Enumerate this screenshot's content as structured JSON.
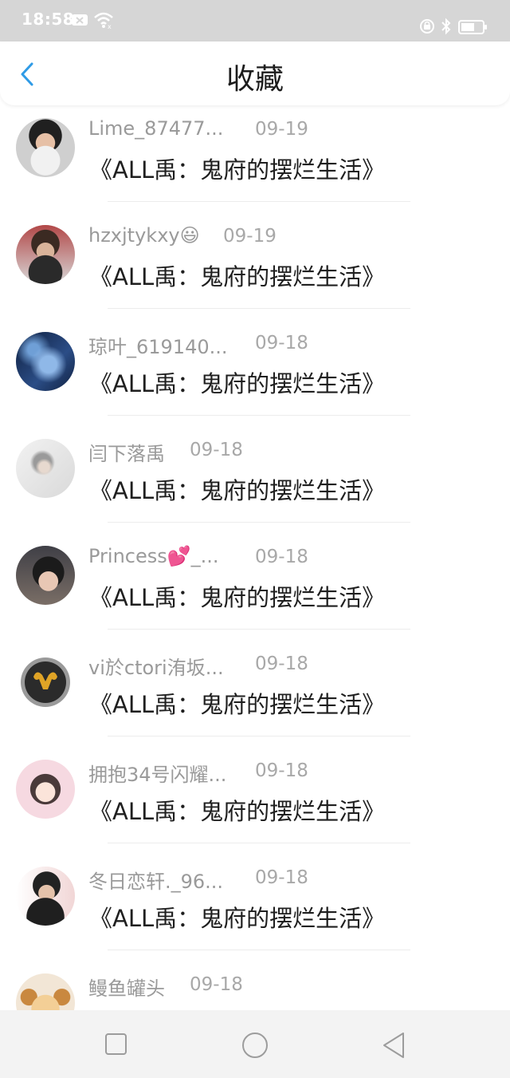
{
  "status_bar": {
    "time": "18:58",
    "icons": [
      "sim-off-icon",
      "wifi-icon",
      "alarm-icon",
      "bluetooth-icon",
      "battery-icon"
    ]
  },
  "header": {
    "title": "收藏",
    "back_icon": "chevron-left-icon",
    "accent_color": "#2f9be6"
  },
  "items": [
    {
      "username": "Lime_87477...",
      "date": "09-19",
      "title": "《ALL禹：鬼府的摆烂生活》"
    },
    {
      "username": "hzxjtykxy😃",
      "date": "09-19",
      "title": "《ALL禹：鬼府的摆烂生活》"
    },
    {
      "username": "琼叶_619140...",
      "date": "09-18",
      "title": "《ALL禹：鬼府的摆烂生活》"
    },
    {
      "username": "闫下落禹",
      "date": "09-18",
      "title": "《ALL禹：鬼府的摆烂生活》"
    },
    {
      "username": "Princess💕_...",
      "date": "09-18",
      "title": "《ALL禹：鬼府的摆烂生活》"
    },
    {
      "username": "vi於ctori洧坂...",
      "date": "09-18",
      "title": "《ALL禹：鬼府的摆烂生活》"
    },
    {
      "username": "拥抱34号闪耀...",
      "date": "09-18",
      "title": "《ALL禹：鬼府的摆烂生活》"
    },
    {
      "username": "冬日恋轩._96...",
      "date": "09-18",
      "title": "《ALL禹：鬼府的摆烂生活》"
    },
    {
      "username": "鳗鱼罐头",
      "date": "09-18",
      "title": ""
    }
  ],
  "nav_bar": {
    "buttons": [
      "recent-apps-icon",
      "home-icon",
      "back-triangle-icon"
    ]
  }
}
